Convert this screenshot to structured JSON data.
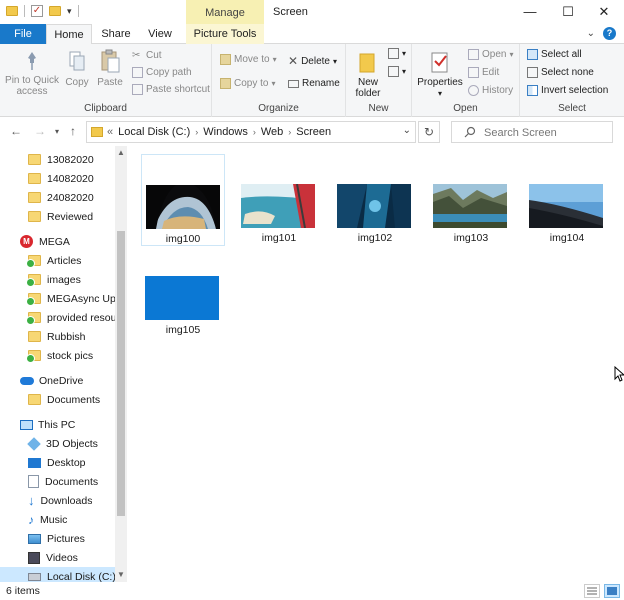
{
  "window": {
    "title": "Screen",
    "context_tab": "Manage",
    "controls": {
      "minimize": "—",
      "maximize": "☐",
      "close": "✕"
    }
  },
  "ribbon_tabs": {
    "file": "File",
    "home": "Home",
    "share": "Share",
    "view": "View",
    "picture_tools": "Picture Tools",
    "help": "?"
  },
  "ribbon": {
    "clipboard": {
      "label": "Clipboard",
      "pin": "Pin to Quick access",
      "copy": "Copy",
      "paste": "Paste",
      "cut": "Cut",
      "copy_path": "Copy path",
      "paste_shortcut": "Paste shortcut"
    },
    "organize": {
      "label": "Organize",
      "move_to": "Move to",
      "copy_to": "Copy to",
      "delete": "Delete",
      "rename": "Rename"
    },
    "new": {
      "label": "New",
      "new_folder": "New folder"
    },
    "open": {
      "label": "Open",
      "properties": "Properties",
      "open": "Open",
      "edit": "Edit",
      "history": "History"
    },
    "select": {
      "label": "Select",
      "select_all": "Select all",
      "select_none": "Select none",
      "invert_selection": "Invert selection"
    }
  },
  "address": {
    "overflow": "«",
    "crumbs": [
      "Local Disk (C:)",
      "Windows",
      "Web",
      "Screen"
    ],
    "search_placeholder": "Search Screen"
  },
  "nav": {
    "items": [
      {
        "label": "13082020",
        "icon": "folder-icon"
      },
      {
        "label": "14082020",
        "icon": "folder-icon"
      },
      {
        "label": "24082020",
        "icon": "folder-icon"
      },
      {
        "label": "Reviewed",
        "icon": "folder-icon"
      },
      {
        "label": "MEGA",
        "icon": "mega-icon"
      },
      {
        "label": "Articles",
        "icon": "synced-folder-icon"
      },
      {
        "label": "images",
        "icon": "synced-folder-icon"
      },
      {
        "label": "MEGAsync Uploads",
        "icon": "synced-folder-icon"
      },
      {
        "label": "provided resources",
        "icon": "synced-folder-icon"
      },
      {
        "label": "Rubbish",
        "icon": "folder-icon"
      },
      {
        "label": "stock pics",
        "icon": "synced-folder-icon"
      },
      {
        "label": "OneDrive",
        "icon": "onedrive-icon"
      },
      {
        "label": "Documents",
        "icon": "folder-icon"
      },
      {
        "label": "This PC",
        "icon": "pc-icon"
      },
      {
        "label": "3D Objects",
        "icon": "3d-objects-icon"
      },
      {
        "label": "Desktop",
        "icon": "desktop-icon"
      },
      {
        "label": "Documents",
        "icon": "documents-icon"
      },
      {
        "label": "Downloads",
        "icon": "downloads-icon"
      },
      {
        "label": "Music",
        "icon": "music-icon"
      },
      {
        "label": "Pictures",
        "icon": "pictures-icon"
      },
      {
        "label": "Videos",
        "icon": "videos-icon"
      },
      {
        "label": "Local Disk (C:)",
        "icon": "drive-icon"
      }
    ]
  },
  "files": [
    {
      "name": "img100"
    },
    {
      "name": "img101"
    },
    {
      "name": "img102"
    },
    {
      "name": "img103"
    },
    {
      "name": "img104"
    },
    {
      "name": "img105"
    }
  ],
  "status": {
    "count": "6 items"
  },
  "colors": {
    "accent": "#1979ca",
    "manage_tab": "#f7f0b3",
    "selection": "#cce8ff",
    "img105_fill": "#0b78d4"
  }
}
